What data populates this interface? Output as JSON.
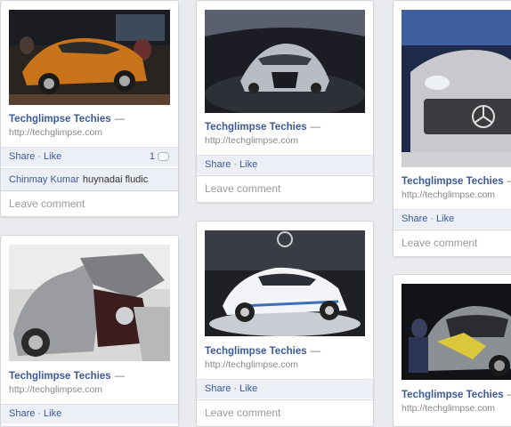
{
  "posts": [
    {
      "title": "Techglimpse Techies",
      "dash": "—",
      "url": "http://techglimpse.com",
      "photo": "orange hatchback car at auto show",
      "share": "Share",
      "sep": "·",
      "like": "Like",
      "comment_count": "1",
      "comment": {
        "author": "Chinmay Kumar",
        "text": "huynadai fludic"
      },
      "leave": "Leave comment"
    },
    {
      "title": "Techglimpse Techies",
      "dash": "—",
      "url": "http://techglimpse.com",
      "photo": "silver concept car on stage",
      "share": "Share",
      "sep": "·",
      "like": "Like",
      "leave": "Leave comment"
    },
    {
      "title": "Techglimpse Techies",
      "dash": "—",
      "url": "http://techglimpse.com",
      "photo": "silver car front grille",
      "share": "Share",
      "sep": "·",
      "like": "Like",
      "leave": "Leave comment"
    },
    {
      "title": "Techglimpse Techies",
      "dash": "—",
      "url": "http://techglimpse.com",
      "photo": "car with open doors",
      "share": "Share",
      "sep": "·",
      "like": "Like"
    },
    {
      "title": "Techglimpse Techies",
      "dash": "—",
      "url": "http://techglimpse.com",
      "photo": "white electric race car",
      "share": "Share",
      "sep": "·",
      "like": "Like",
      "leave": "Leave comment"
    },
    {
      "title": "Techglimpse Techies",
      "dash": "—",
      "url": "http://techglimpse.com",
      "photo": "car being painted",
      "share": "",
      "like": ""
    }
  ],
  "colors": {
    "link": "#3b5998",
    "bar": "#eceff5",
    "page_bg": "#e9ebee"
  }
}
